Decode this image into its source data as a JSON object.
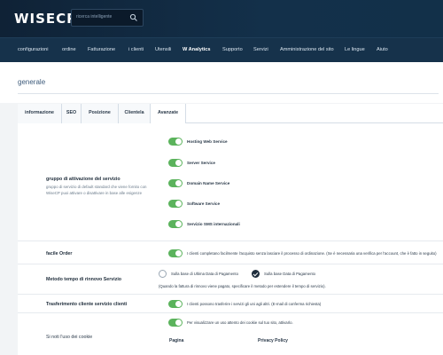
{
  "app": {
    "logo": "WISECP"
  },
  "search": {
    "placeholder": "ricerca intelligente"
  },
  "nav": [
    {
      "label": "configurazioni"
    },
    {
      "label": "ordine"
    },
    {
      "label": "Fatturazione"
    },
    {
      "label": "i clienti"
    },
    {
      "label": "Utensili"
    },
    {
      "label": "W Analytics"
    },
    {
      "label": "Supporto"
    },
    {
      "label": "Servizi"
    },
    {
      "label": "Amministrazione del sito"
    },
    {
      "label": "Le lingue"
    },
    {
      "label": "Aiuto"
    }
  ],
  "page": {
    "title": "generale"
  },
  "tabs": [
    {
      "label": "informazione"
    },
    {
      "label": "SEO"
    },
    {
      "label": "Posizione"
    },
    {
      "label": "Clientela"
    },
    {
      "label": "Avanzate"
    }
  ],
  "service_group": {
    "label": "gruppo di attivazione del servizio",
    "desc": "gruppo di servizio di default standard che viene fornito con WiseCP puoi attivare o disattivare in base alle esigenze",
    "options": [
      {
        "label": "Hosting Web Service",
        "on": true
      },
      {
        "label": "Server Service",
        "on": true
      },
      {
        "label": "Domain Name Service",
        "on": true
      },
      {
        "label": "Software Service",
        "on": true
      },
      {
        "label": "Servizio SMS internazionali",
        "on": true
      }
    ]
  },
  "easy_order": {
    "label": "facile Order",
    "text": "I clienti completano facilmente l'acquisto senza lasciare il processo di ordinazione. (Se è necessaria una verifica per l'account, che è fatto in seguito)"
  },
  "renewal": {
    "label": "Metodo tempo di rinnovo Servizio",
    "option1": "Sulla base di Ultima Data di Pagamento",
    "option2": "Sulla base Data di Pagamento",
    "selected": "option2",
    "note": "(Quando la fattura di rinnovo viene pagato, specificare il metodo per estendere il tempo di servizio)."
  },
  "transfer": {
    "label": "Trasferimento cliente servizio clienti",
    "text": "I clienti possono trasferire i servizi gli uni agli altri. (E-mail di conferma richiesta)"
  },
  "cookies": {
    "label": "Si noti l'uso dei cookie",
    "text": "Per visualizzare un uso attento dei cookie sul tuo sito, attivarlo.",
    "col_page": "Pagina",
    "col_privacy": "Privacy Policy"
  },
  "colors": {
    "accent": "#5bb35c",
    "topbar": "#0f2236",
    "nav": "#16324b"
  }
}
